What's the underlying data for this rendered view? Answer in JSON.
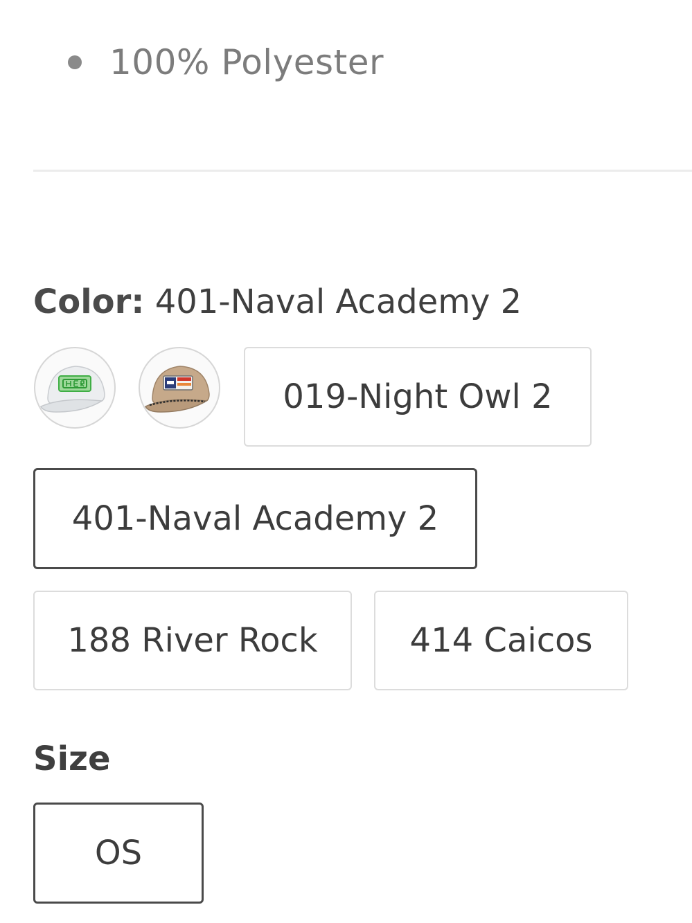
{
  "details": {
    "bullets": [
      "100% Polyester"
    ]
  },
  "color_selector": {
    "label_prefix": "Color:",
    "selected_value": "401-Naval Academy 2",
    "swatches": [
      {
        "icon": "white-cap-green-logo-swatch"
      },
      {
        "icon": "tan-rope-cap-flag-patch-swatch"
      }
    ],
    "options": [
      {
        "label": "019-Night Owl 2",
        "selected": false
      },
      {
        "label": "401-Naval Academy 2",
        "selected": true
      },
      {
        "label": "188 River Rock",
        "selected": false
      },
      {
        "label": "414 Caicos",
        "selected": false
      }
    ]
  },
  "size_selector": {
    "label": "Size",
    "options": [
      {
        "label": "OS",
        "selected": true
      }
    ]
  },
  "colors": {
    "border": "#dcdcdc",
    "selected_border": "#4a4a4a",
    "divider": "#ececec",
    "muted_text": "#7c7c7c",
    "text": "#3c3c3c"
  }
}
